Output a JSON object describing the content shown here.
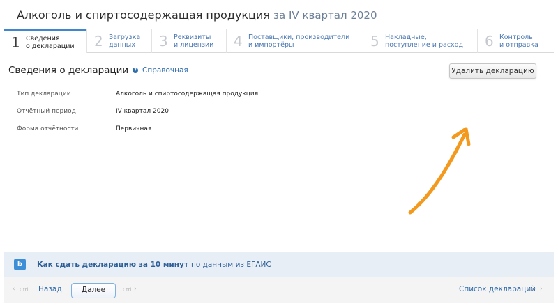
{
  "header": {
    "title": "Алкоголь и спиртосодержащая продукция",
    "period": "за IV квартал 2020"
  },
  "steps": [
    {
      "num": "1",
      "label": "Сведения\nо декларации",
      "active": true
    },
    {
      "num": "2",
      "label": "Загрузка\nданных",
      "active": false
    },
    {
      "num": "3",
      "label": "Реквизиты\nи лицензии",
      "active": false
    },
    {
      "num": "4",
      "label": "Поставщики, производители\nи импортёры",
      "active": false
    },
    {
      "num": "5",
      "label": "Накладные,\nпоступление и расход",
      "active": false
    },
    {
      "num": "6",
      "label": "Контроль\nи отправка",
      "active": false
    }
  ],
  "main": {
    "section_title": "Сведения о декларации",
    "help_icon": "question-circle-icon",
    "help_label": "Справочная",
    "delete_label": "Удалить декларацию",
    "fields": [
      {
        "key": "Тип декларации",
        "value": "Алкоголь и спиртосодержащая продукция"
      },
      {
        "key": "Отчётный период",
        "value": "IV квартал 2020"
      },
      {
        "key": "Форма отчётности",
        "value": "Первичная"
      }
    ]
  },
  "promo": {
    "logo_icon": "kontur-logo-icon",
    "logo_glyph": "b",
    "bold_text": "Как сдать декларацию за 10 минут",
    "rest_text": "по данным из ЕГАИС"
  },
  "footer": {
    "back_label": "Назад",
    "back_kbd": "Ctrl",
    "next_label": "Далее",
    "next_kbd": "Ctrl",
    "list_label": "Список деклараций",
    "list_kbd": "Ctrl"
  },
  "colors": {
    "accent": "#3f86d0",
    "link": "#2f6cae",
    "arrow": "#f39a1e",
    "promo_bg": "#e8eef6"
  }
}
